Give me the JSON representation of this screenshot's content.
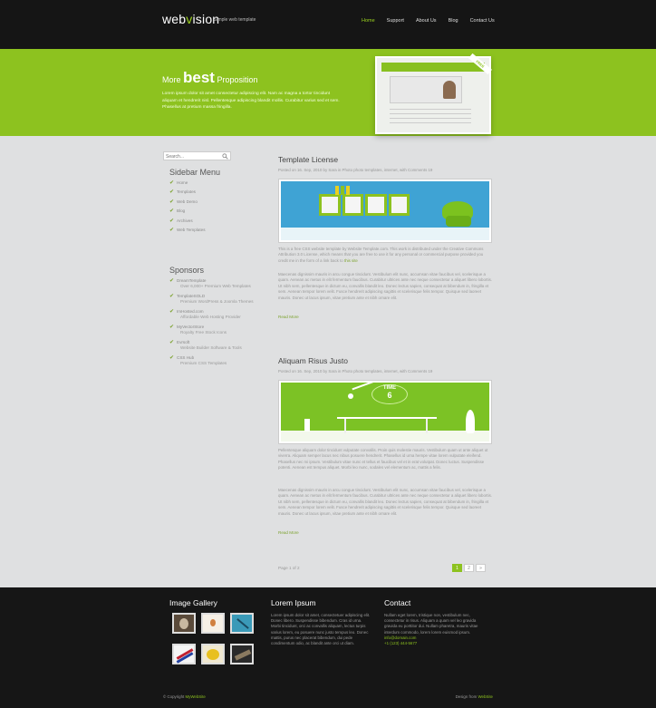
{
  "header": {
    "logo_part1": "web",
    "logo_part2": "v",
    "logo_part3": "ision",
    "tagline": "Simple web template",
    "nav": [
      "Home",
      "Support",
      "About Us",
      "Blog",
      "Contact Us"
    ]
  },
  "banner": {
    "title_pre": "More ",
    "title_big": "best",
    "title_post": " Proposition",
    "text": "Lorem ipsum dolor sit amet consectetur adipiscing elit. Nam ac magna a tortor tincidunt aliquam et hendrerit nisl. Pellentesque adipiscing blandit mollis. Curabitur varius sed et sem. Phasellus at pretium massa fringilla.",
    "ribbon": "FREE"
  },
  "sidebar": {
    "search_placeholder": "Search...",
    "menu_heading": "Sidebar Menu",
    "menu_items": [
      "Home",
      "Templates",
      "Web Demo",
      "Blog",
      "Archives",
      "Web Templates"
    ],
    "sponsors_heading": "Sponsors",
    "sponsors": [
      {
        "name": "DreamTemplate",
        "desc": "Over 6,000+ Premium Web Templates"
      },
      {
        "name": "TemplateSOLD",
        "desc": "Premium WordPress & Joomla Themes"
      },
      {
        "name": "ImHosted.com",
        "desc": "Affordable Web Hosting Provider"
      },
      {
        "name": "MyVectorStore",
        "desc": "Royalty Free Stock Icons"
      },
      {
        "name": "Evrsoft",
        "desc": "Website Builder Software & Tools"
      },
      {
        "name": "CSS Hub",
        "desc": "Premium CSS Templates"
      }
    ]
  },
  "posts": [
    {
      "title": "Template License",
      "meta": "Posted on 16. Sep, 2010 by Sara in Photo photo templates, internet, with Comments 19",
      "body1": "This is a free CSS website template by Website Template.com. This work is distributed under the Creative Commons Attribution 3.0 License, which means that you are free to use it for any personal or commercial purpose provided you credit me in the form of a link back to ",
      "body1_link": "this site",
      "body2": "Maecenas dignissim mauris in arcu congue tincidunt. Vestibulum elit nunc, accumsan vitae faucibus vel, scelerisque a quam. Aenean ac metus in elit fermentum faucibus. Curabitur ultrices ante nec neque consectetur a aliquet libero lobortis. Ut nibh sem, pellentesque in dictum eu, convallis blandit leo. Donec lectus sapien, consequat at bibendum in, fringilla et sem. Aenean tempor lorem velit. Fusce hendrerit adipiscing sagittis et scelerisque felis tempor. Quisque sed laoreet mauris. Donec ut lacus ipsum, vitae pretium ante et nibh ornare elit.",
      "more": "Read More"
    },
    {
      "title": "Aliquam Risus Justo",
      "meta": "Posted on 16. Sep, 2010 by Sara in Photo photo templates, internet, with Comments 19",
      "body1": "Pellentesque aliquam dolor tincidunt vulputate convallis. Proin quis molestie mauris. Vestibulum quam ut ante aliquet ut viverra. Aliquam semper lacus nec nibus posuere hendrerit. Phasellus id urna hempe vitae lorem vulputate eleifend. Phasellus nec mi ipsum. Vestibulum vitae nunc et tellus et faucibus vel et in erat volutpat. Donec luctus. Suspendisse potenti. Aenean est tempus aliquet. Morbi leo nunc, sodales vel elementum ac, mattis a felis.",
      "body1_link": "",
      "body2": "Maecenas dignissim mauris in arcu congue tincidunt. Vestibulum elit nunc, accumsan vitae faucibus vel, scelerisque a quam. Aenean ac metus in elit fermentum faucibus. Curabitur ultrices ante nec neque consectetur a aliquet libero lobortis. Ut nibh sem, pellentesque in dictum eu, convallis blandit leo. Donec lectus sapien, consequat at bibendum in, fringilla et sem. Aenean tempor lorem velit. Fusce hendrerit adipiscing sagittis et scelerisque felis tempor. Quisque sed laoreet mauris. Donec ut lacus ipsum, vitae pretium ante et nibh ornare elit.",
      "more": "Read More",
      "clock_label": "TIME",
      "clock_value": "6"
    }
  ],
  "pagination": {
    "text": "Page 1 of 2",
    "pages": [
      "1",
      "2",
      "»"
    ]
  },
  "footer": {
    "gallery_heading": "Image Gallery",
    "lorem_heading": "Lorem Ipsum",
    "lorem_text": "Lorem ipsum dolor sit amet, consectetuer adipiscing elit. Donec libero. Suspendisse bibendum. Cras id urna. Morbi tincidunt, orci ac convallis aliquam, lectus turpis varius lorem, eu posuere nunc justo tempus leo. Donec mattis, purus nec placerat bibendum, dui pede condimentum odio, ac blandit ante orci ut diam.",
    "contact_heading": "Contact",
    "contact_text": "Nullam eget lorem, tristique non, vestibulum nec, consectetur in risus. Aliquam a quam vel leo gravida gravida eu porttitor dui. Nullam pharetra, mauris vitae interdum commodo, lorem lorem euismod ipsum.",
    "contact_email": "info@domain.com",
    "contact_phone": "+1 (123) 444-5677",
    "copyright_prefix": "© Copyright ",
    "copyright_link": "MyWebSite",
    "credit_prefix": "Design from ",
    "credit_link": "WebSite"
  },
  "colors": {
    "accent": "#8dc21f",
    "header_bg": "#151515",
    "body_bg": "#dfe0e1",
    "footer_bg": "#161616"
  }
}
